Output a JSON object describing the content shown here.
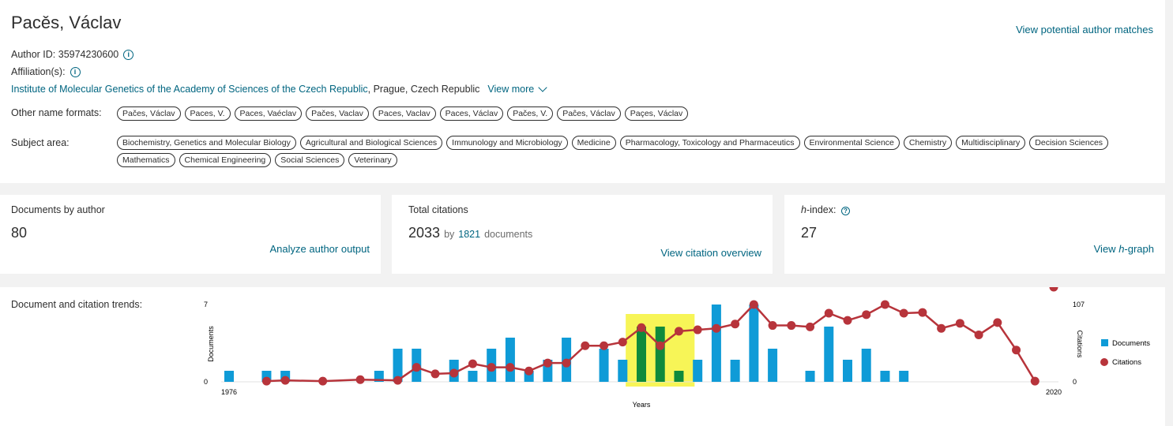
{
  "author": {
    "name": "Pacěs, Václav",
    "id_label": "Author ID: 35974230600",
    "affiliation_label": "Affiliation(s):",
    "institution": "Institute of Molecular Genetics of the Academy of Sciences of the Czech Republic",
    "location": ", Prague, Czech Republic",
    "view_more": "View more",
    "potential_matches": "View potential author matches"
  },
  "other_names": {
    "label": "Other name formats:",
    "items": [
      "Pačes, Václav",
      "Paces, V.",
      "Paces, Vaéclav",
      "Pačes, Vaclav",
      "Paces, Vaclav",
      "Paces, Václav",
      "Pačes, V.",
      "Paĉes, Václav",
      "Paçes, Václav"
    ]
  },
  "subject": {
    "label": "Subject area:",
    "items": [
      "Biochemistry, Genetics and Molecular Biology",
      "Agricultural and Biological Sciences",
      "Immunology and Microbiology",
      "Medicine",
      "Pharmacology, Toxicology and Pharmaceutics",
      "Environmental Science",
      "Chemistry",
      "Multidisciplinary",
      "Decision Sciences",
      "Mathematics",
      "Chemical Engineering",
      "Social Sciences",
      "Veterinary"
    ]
  },
  "metrics": {
    "documents": {
      "title": "Documents by author",
      "value": "80",
      "link": "Analyze author output"
    },
    "citations": {
      "title": "Total citations",
      "value": "2033",
      "by": "by",
      "docs_count": "1821",
      "docs_word": "documents",
      "link": "View citation overview"
    },
    "hindex": {
      "title_italic": "h",
      "title_rest": "-index:",
      "value": "27",
      "link_prefix": "View ",
      "link_italic": "h",
      "link_suffix": "-graph"
    }
  },
  "trends": {
    "title": "Document and citation trends:"
  },
  "colors": {
    "link": "#006580",
    "bar": "#0f9bd7",
    "highlight_bar": "#0f8a3c",
    "line": "#b7343b",
    "highlight_bg": "#f7f557"
  },
  "chart_data": {
    "type": "bar+line",
    "xlabel": "Years",
    "y_left_label": "Documents",
    "y_right_label": "Citations",
    "x_min_label": "1976",
    "x_max_label": "2020",
    "y_left_min": "0",
    "y_left_max": "7",
    "y_right_min": "0",
    "y_right_max": "107",
    "xlim": [
      1976,
      2020
    ],
    "ylim_left": [
      0,
      7
    ],
    "ylim_right": [
      0,
      107
    ],
    "highlight_years": [
      1998,
      2000
    ],
    "legend": [
      "Documents",
      "Citations"
    ],
    "documents": {
      "x": [
        1976,
        1978,
        1979,
        1984,
        1985,
        1986,
        1988,
        1989,
        1990,
        1991,
        1992,
        1993,
        1994,
        1996,
        1997,
        1998,
        1999,
        2000,
        2001,
        2002,
        2003,
        2004,
        2005,
        2007,
        2008,
        2009,
        2010,
        2011,
        2012
      ],
      "values": [
        1,
        1,
        1,
        1,
        3,
        3,
        2,
        1,
        3,
        4,
        1,
        2,
        4,
        3,
        2,
        5,
        5,
        1,
        2,
        7,
        2,
        7,
        3,
        1,
        5,
        2,
        3,
        1,
        1
      ]
    },
    "citations": {
      "x": [
        1978,
        1979,
        1981,
        1983,
        1985,
        1986,
        1987,
        1988,
        1989,
        1990,
        1991,
        1992,
        1993,
        1994,
        1995,
        1996,
        1997,
        1998,
        1999,
        2000,
        2001,
        2002,
        2003,
        2004,
        2005,
        2006,
        2007,
        2008,
        2009,
        2010,
        2011,
        2012,
        2013,
        2014,
        2015,
        2016,
        2017,
        2018,
        2019,
        2020
      ],
      "values": [
        1,
        2,
        1,
        3,
        2,
        20,
        11,
        12,
        25,
        20,
        20,
        15,
        26,
        26,
        50,
        50,
        55,
        75,
        50,
        70,
        72,
        74,
        80,
        107,
        78,
        78,
        76,
        95,
        85,
        93,
        107,
        95,
        96,
        74,
        81,
        65,
        82,
        44,
        1
      ]
    }
  }
}
